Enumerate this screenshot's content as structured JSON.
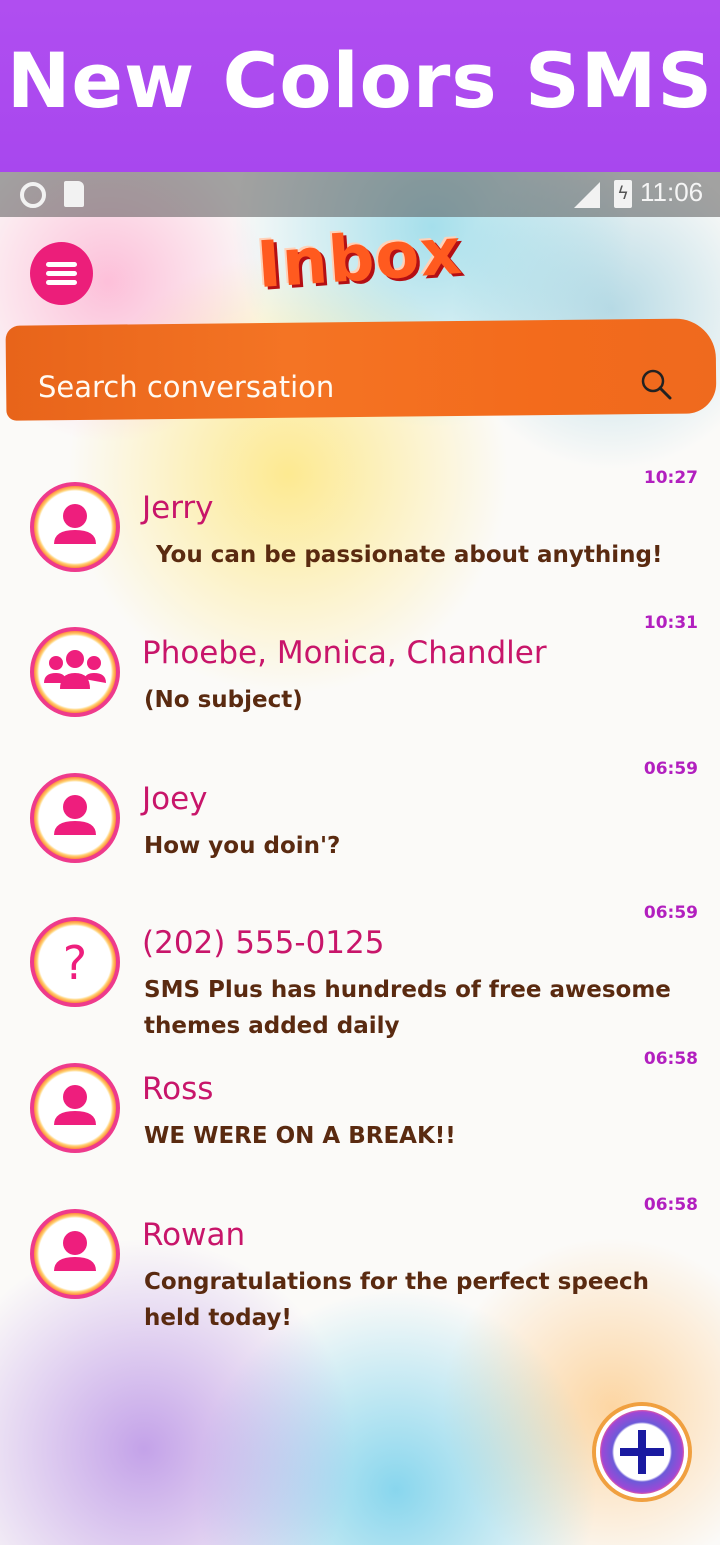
{
  "banner": {
    "title": "New Colors SMS"
  },
  "status_bar": {
    "time": "11:06",
    "icons": [
      "sync-icon",
      "sd-card-icon",
      "signal-icon",
      "battery-charging-icon"
    ]
  },
  "header": {
    "title": "Inbox",
    "menu_icon": "hamburger-menu-icon"
  },
  "search": {
    "placeholder": "Search conversation",
    "icon": "search-icon"
  },
  "conversations": [
    {
      "name": "Jerry",
      "snippet": "You can be passionate about anything!",
      "time": "10:27",
      "avatar": "person-icon"
    },
    {
      "name": "Phoebe, Monica, Chandler",
      "snippet": "(No subject)",
      "time": "10:31",
      "avatar": "group-icon"
    },
    {
      "name": "Joey",
      "snippet": "How you doin'?",
      "time": "06:59",
      "avatar": "person-icon"
    },
    {
      "name": "(202) 555-0125",
      "snippet": "SMS Plus has hundreds of free awesome themes added daily",
      "time": "06:59",
      "avatar": "unknown-contact-icon"
    },
    {
      "name": "Ross",
      "snippet": "WE WERE ON A BREAK!!",
      "time": "06:58",
      "avatar": "person-icon"
    },
    {
      "name": "Rowan",
      "snippet": "Congratulations for the perfect speech held today!",
      "time": "06:58",
      "avatar": "person-icon"
    }
  ],
  "fab": {
    "icon": "plus-icon"
  },
  "colors": {
    "banner": "#a847ee",
    "accent_pink": "#ec1e7a",
    "search_orange": "#f47424",
    "time_purple": "#b21fbf",
    "snippet_brown": "#5a2a10"
  }
}
